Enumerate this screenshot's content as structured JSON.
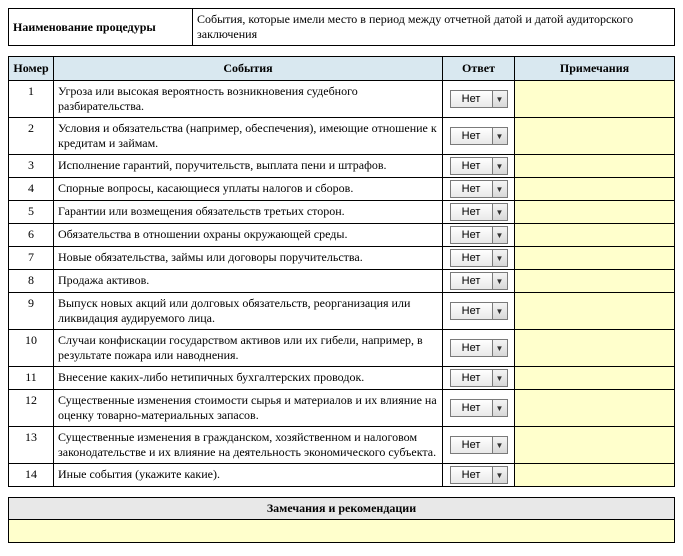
{
  "header": {
    "label": "Наименование процедуры",
    "value": "События, которые имели место в период между отчетной датой и датой аудиторского заключения"
  },
  "columns": {
    "number": "Номер",
    "event": "События",
    "answer": "Ответ",
    "notes": "Примечания"
  },
  "default_answer": "Нет",
  "rows": [
    {
      "num": "1",
      "event": "Угроза или высокая вероятность возникновения судебного разбирательства.",
      "answer": "Нет",
      "note": ""
    },
    {
      "num": "2",
      "event": "Условия и обязательства (например, обеспечения), имеющие отношение к кредитам и займам.",
      "answer": "Нет",
      "note": ""
    },
    {
      "num": "3",
      "event": "Исполнение гарантий, поручительств, выплата пени и штрафов.",
      "answer": "Нет",
      "note": ""
    },
    {
      "num": "4",
      "event": "Спорные вопросы, касающиеся уплаты налогов и сборов.",
      "answer": "Нет",
      "note": ""
    },
    {
      "num": "5",
      "event": "Гарантии или возмещения обязательств третьих сторон.",
      "answer": "Нет",
      "note": ""
    },
    {
      "num": "6",
      "event": "Обязательства в отношении охраны окружающей среды.",
      "answer": "Нет",
      "note": ""
    },
    {
      "num": "7",
      "event": "Новые обязательства, займы или договоры  поручительства.",
      "answer": "Нет",
      "note": ""
    },
    {
      "num": "8",
      "event": "Продажа активов.",
      "answer": "Нет",
      "note": ""
    },
    {
      "num": "9",
      "event": "Выпуск новых акций или долговых обязательств, реорганизация или ликвидация аудируемого лица.",
      "answer": "Нет",
      "note": ""
    },
    {
      "num": "10",
      "event": "Случаи конфискации государством активов или их гибели, например, в результате пожара или наводнения.",
      "answer": "Нет",
      "note": ""
    },
    {
      "num": "11",
      "event": "Внесение каких-либо нетипичных бухгалтерских проводок.",
      "answer": "Нет",
      "note": ""
    },
    {
      "num": "12",
      "event": "Существенные изменения стоимости сырья и материалов и их влияние на оценку товарно-материальных запасов.",
      "answer": "Нет",
      "note": ""
    },
    {
      "num": "13",
      "event": "Существенные изменения в гражданском, хозяйственном и налоговом законодательстве и их влияние на деятельность экономического субъекта.",
      "answer": "Нет",
      "note": ""
    },
    {
      "num": "14",
      "event": "Иные события (укажите какие).",
      "answer": "Нет",
      "note": ""
    }
  ],
  "remarks": {
    "title": "Замечания и рекомендации",
    "body": ""
  }
}
